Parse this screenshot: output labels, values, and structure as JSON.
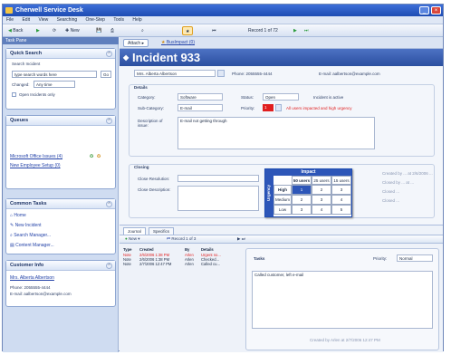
{
  "app": {
    "title": "Cherwell Service Desk"
  },
  "menu": [
    "File",
    "Edit",
    "View",
    "Searching",
    "One-Step",
    "Tools",
    "Help"
  ],
  "toolbar": {
    "back": "Back",
    "new": "New",
    "record": "Record 1 of 72"
  },
  "sidebar": {
    "header": "Task Pane",
    "quick_search": {
      "title": "Quick Search",
      "search_label": "Search Incident",
      "search_placeholder": "type search words here",
      "go": "Go",
      "changed_label": "Changed:",
      "changed_value": "Any time",
      "open_only": "Open Incidents only"
    },
    "queues": {
      "title": "Queues",
      "items": [
        "Microsoft Office Issues (4)",
        "New Employee Setup (0)"
      ]
    },
    "common_tasks": {
      "title": "Common Tasks",
      "items": [
        "Home",
        "New Incident",
        "Search Manager...",
        "Content Manager..."
      ]
    },
    "customer_info": {
      "title": "Customer Info",
      "name": "Mrs. Alberta Albertson",
      "phone": "Phone: 2055555-4444",
      "email": "E-mail: aalbertson@example.com"
    }
  },
  "main": {
    "tabs": {
      "attach": "Attach",
      "bus_impact": "BusImpact (0)"
    },
    "title": "Incident 933",
    "customer": "Mrs. Alberta Albertson",
    "phone": "Phone: 2055555-4444",
    "email": "E-mail: aalbertson@example.com",
    "details": {
      "title": "Details",
      "category_label": "Category:",
      "category_value": "Software",
      "subcategory_label": "Sub-Category:",
      "subcategory_value": "E-mail",
      "status_label": "Status:",
      "status_value": "Open",
      "priority_label": "Priority:",
      "priority_value": "1",
      "priority_note": "All users impacted and high urgency",
      "incident_active": "Incident is active",
      "description_label": "Description of issue:",
      "description_value": "E-mail not getting through"
    },
    "closing": {
      "title": "Closing",
      "close_resolution": "Close Resolution:",
      "close_description": "Close Description:",
      "right_labels": [
        "Created by ... at 2/6/2006 ...",
        "Closed by ... at ...",
        "Closed ...",
        "Closed ..."
      ]
    },
    "matrix": {
      "title": "Impact",
      "side": "Urgency",
      "columns": [
        "50 users",
        "25 users",
        "15 users"
      ],
      "rows": [
        {
          "label": "High",
          "values": [
            "1",
            "2",
            "3"
          ]
        },
        {
          "label": "Medium",
          "values": [
            "2",
            "3",
            "4"
          ]
        },
        {
          "label": "Low",
          "values": [
            "3",
            "4",
            "5"
          ]
        }
      ]
    }
  },
  "journal": {
    "tabs": [
      "Journal",
      "Specifics"
    ],
    "new": "New",
    "record": "Record 1 of 3",
    "headers": [
      "Type",
      "Created",
      "By",
      "Details"
    ],
    "rows": [
      {
        "type": "Note",
        "created": "2/6/2006 1:38 PM",
        "by": "Arlen",
        "details": "Urgent no..."
      },
      {
        "type": "Note",
        "created": "2/6/2006 1:38 PM",
        "by": "Arlen",
        "details": "Checked..."
      },
      {
        "type": "Note",
        "created": "2/7/2006 12:47 PM",
        "by": "Arlen",
        "details": "Called cu..."
      }
    ],
    "tasks": {
      "title": "Tasks",
      "priority_label": "Priority:",
      "priority_value": "Normal",
      "text": "Called customer, left e-mail",
      "footer": "Created by Arlen at 2/7/2006 12:47 PM"
    }
  },
  "colors": {
    "accent": "#2b4f9f",
    "priority_red": "#e01e1e"
  }
}
